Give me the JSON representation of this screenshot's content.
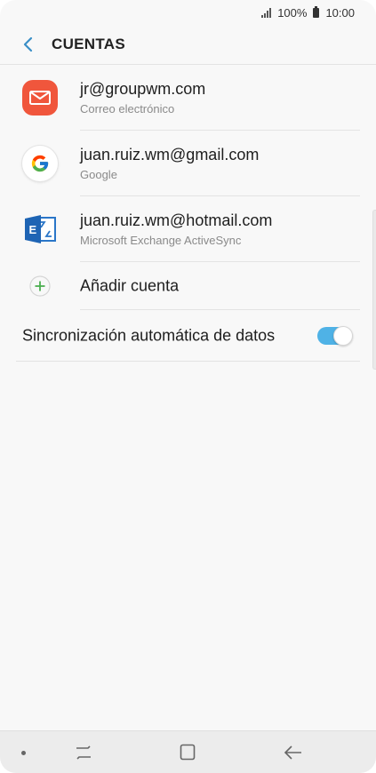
{
  "status_bar": {
    "battery_text": "100%",
    "time": "10:00"
  },
  "header": {
    "title": "CUENTAS",
    "back_icon": "chevron-left-icon"
  },
  "accounts": [
    {
      "primary": "jr@groupwm.com",
      "secondary": "Correo electrónico",
      "icon": "email-app-icon",
      "icon_color": "#f0563c"
    },
    {
      "primary": "juan.ruiz.wm@gmail.com",
      "secondary": "Google",
      "icon": "google-icon"
    },
    {
      "primary": "juan.ruiz.wm@hotmail.com",
      "secondary": "Microsoft Exchange ActiveSync",
      "icon": "exchange-icon",
      "icon_color": "#1e64b4"
    }
  ],
  "add_account": {
    "label": "Añadir cuenta",
    "icon": "plus-icon",
    "icon_color": "#4caf50"
  },
  "sync": {
    "label": "Sincronización automática de datos",
    "enabled": true,
    "accent": "#4fb2e6"
  },
  "nav_bar": {
    "icons": [
      "recent-apps-icon",
      "home-icon",
      "back-icon"
    ]
  }
}
